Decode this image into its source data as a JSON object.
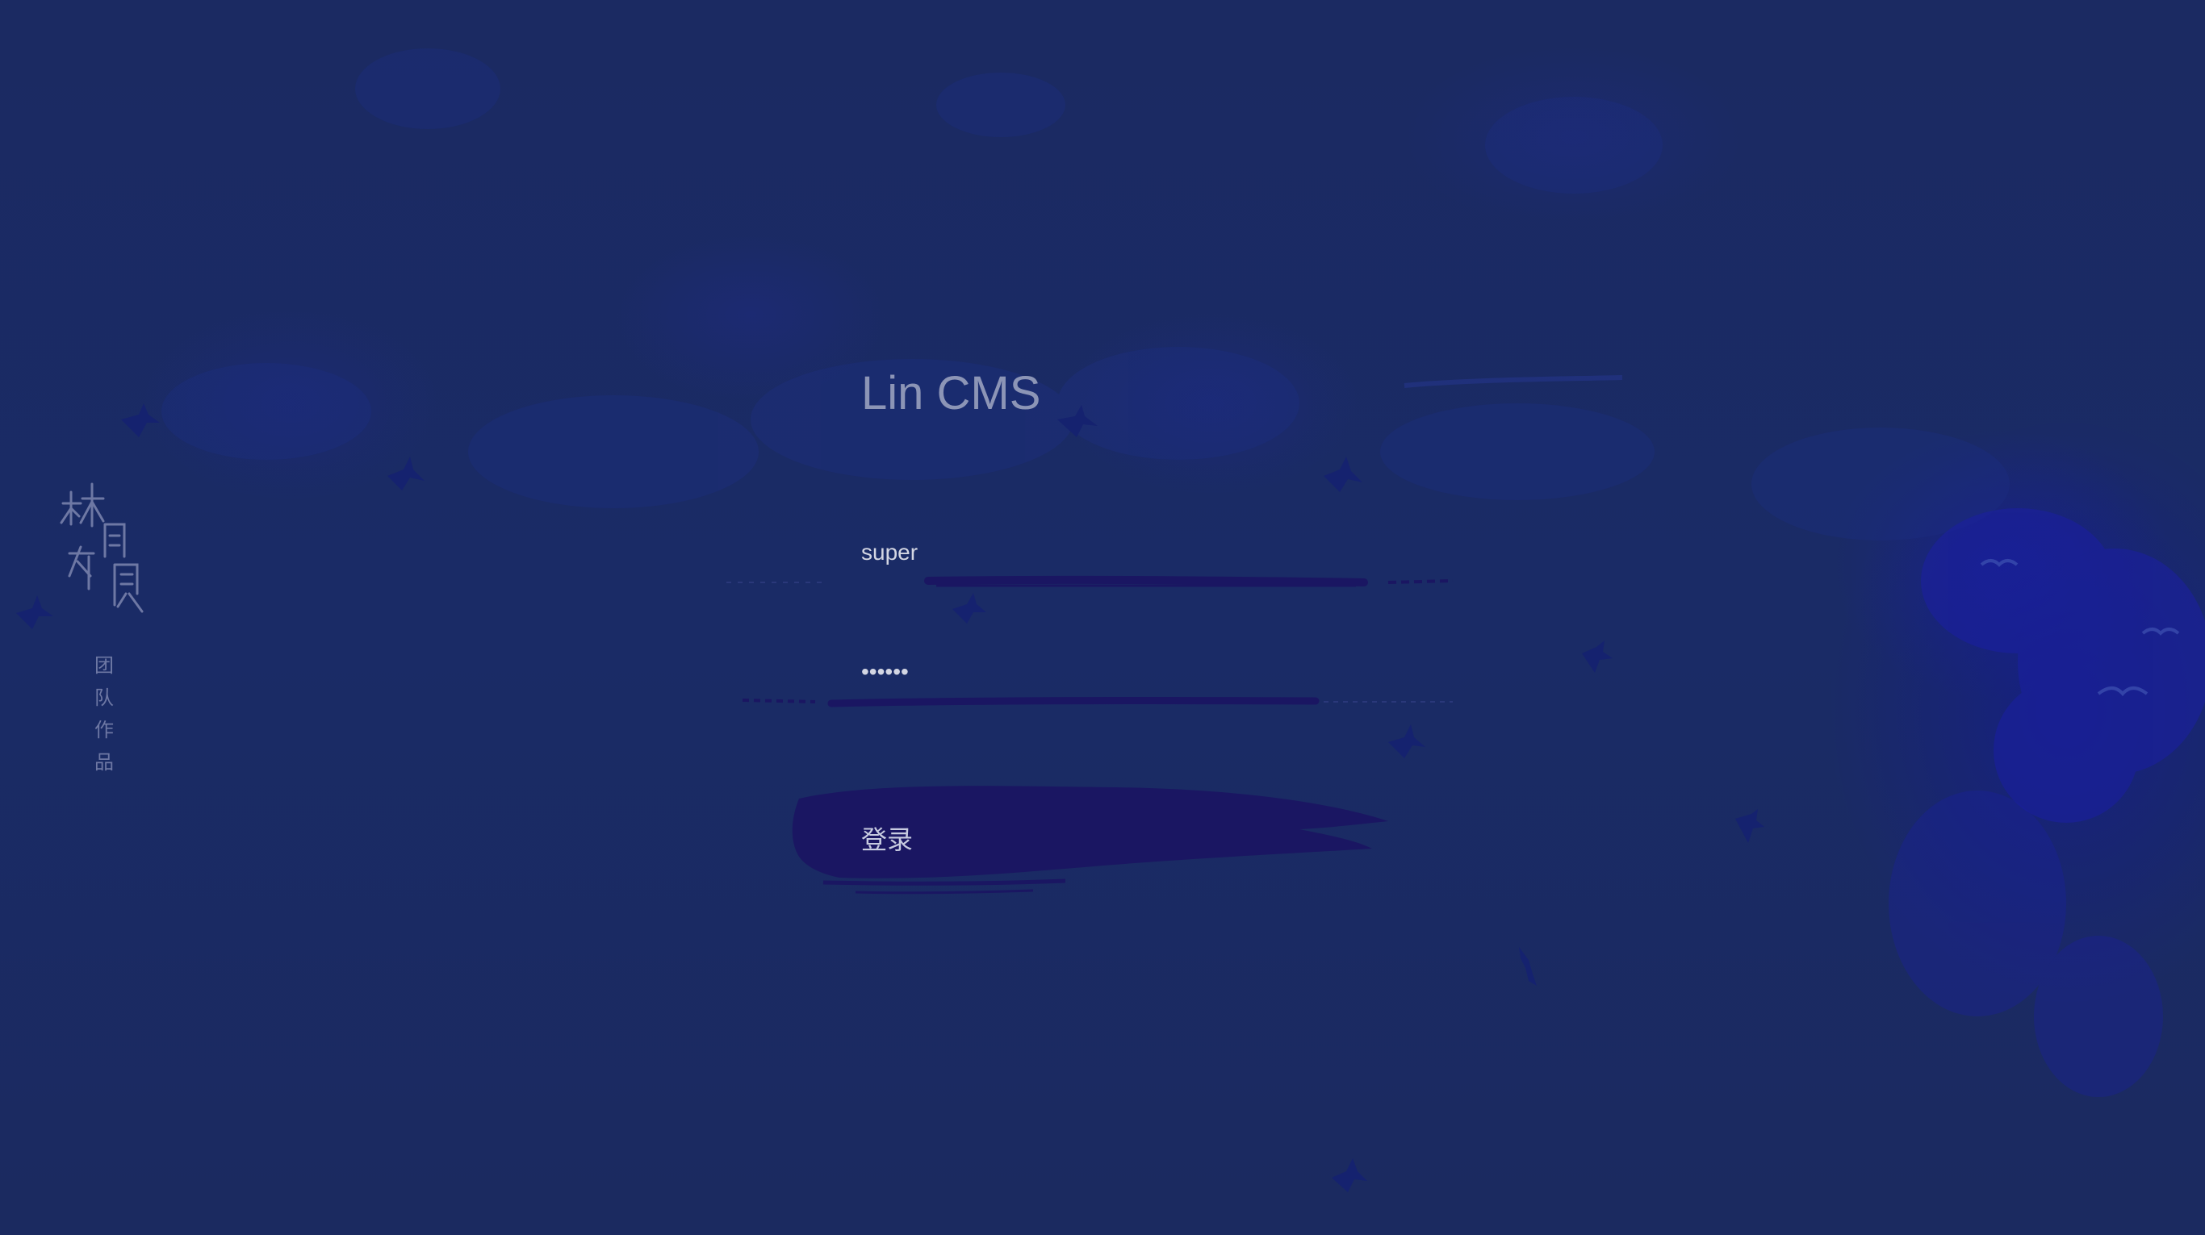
{
  "app": {
    "title": "Lin CMS"
  },
  "brand": {
    "calligraphy": "林间有风",
    "team_chars": [
      "团",
      "队",
      "作",
      "品"
    ]
  },
  "login_form": {
    "username_value": "super",
    "password_value": "123456",
    "submit_label": "登录"
  },
  "colors": {
    "background": "#1b2a62",
    "brush_stroke": "#1a1662",
    "title_text": "#8c95b6",
    "input_text": "#d3d6e3",
    "brand_text": "#6e78a4",
    "bird_silhouette": "#15226f"
  },
  "icons": {
    "birds": "bird-silhouette-icon"
  }
}
